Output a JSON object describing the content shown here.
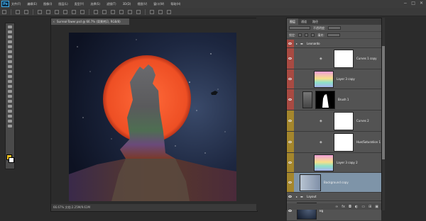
{
  "app": {
    "logo_text": "Ps"
  },
  "menu": [
    "文件(F)",
    "编辑(E)",
    "图像(I)",
    "图层(L)",
    "类型(Y)",
    "选择(S)",
    "滤镜(T)",
    "3D(D)",
    "视图(V)",
    "窗口(W)",
    "帮助(H)"
  ],
  "window_controls": [
    "−",
    "□",
    "✕"
  ],
  "document": {
    "tab_title": "Surreal-Tower.psd @ 66.7% (背景拷贝, RGB/8)",
    "status": "66.67%    文档:2.25M/9.61M"
  },
  "colors": {
    "foreground": "#f0c020",
    "background": "#ffffff",
    "sun": "#f0552a",
    "sky": "#18223a",
    "red_tag": "#a84a42",
    "yellow_tag": "#a4862c",
    "selected_row": "#7e94a8"
  },
  "panel": {
    "tabs": [
      "图层",
      "通道",
      "路径"
    ],
    "mode_row": "正常",
    "opacity_label": "不透明度:",
    "lock_label": "锁定:",
    "fill_label": "填充:"
  },
  "layers": [
    {
      "kind": "group",
      "name": "Leonardo",
      "tag": "red"
    },
    {
      "kind": "adjust",
      "name": "Curves 1 copy",
      "thumb": "white",
      "tag": "red"
    },
    {
      "kind": "layer",
      "name": "Layer 3 copy",
      "thumb": "rainbow",
      "tag": "red"
    },
    {
      "kind": "masked",
      "name": "Brush 1",
      "thumb": "mask",
      "tag": "red"
    },
    {
      "kind": "adjust",
      "name": "Curves 2",
      "thumb": "white",
      "tag": "yellow"
    },
    {
      "kind": "adjust",
      "name": "Hue/Saturation 1",
      "thumb": "white",
      "tag": "yellow"
    },
    {
      "kind": "layer",
      "name": "Layer 3 copy 2",
      "thumb": "rainbow",
      "tag": "yellow"
    },
    {
      "kind": "layer",
      "name": "Background copy",
      "thumb": "grey",
      "tag": "yellow",
      "selected": true
    },
    {
      "kind": "group",
      "name": "Layout",
      "tag": "none"
    },
    {
      "kind": "layer",
      "name": "Bg",
      "thumb": "dark",
      "tag": "none"
    }
  ],
  "panel_footer_icons": [
    "link-icon",
    "fx-icon",
    "mask-icon",
    "adjust-icon",
    "folder-icon",
    "new-layer-icon",
    "trash-icon"
  ]
}
